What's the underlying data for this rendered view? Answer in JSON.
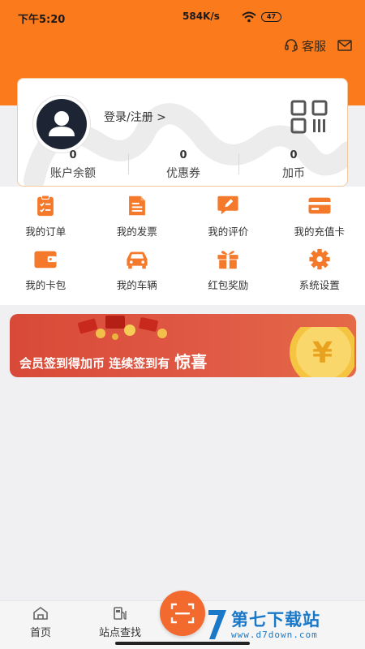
{
  "status_bar": {
    "time": "下午5:20",
    "network_speed": "584K/s",
    "battery": "47"
  },
  "header": {
    "customer_service_label": "客服",
    "customer_service_icon": "headset-icon",
    "message_icon": "mail-icon",
    "brand_color": "#fb7a1b"
  },
  "profile": {
    "avatar_icon": "user-avatar-icon",
    "login_label": "登录/注册 >",
    "qr_icon": "qr-code-icon",
    "stats": [
      {
        "value": "0",
        "label": "账户余额"
      },
      {
        "value": "0",
        "label": "优惠券"
      },
      {
        "value": "0",
        "label": "加币"
      }
    ]
  },
  "menu": {
    "icon_color": "#f4792a",
    "items": [
      {
        "label": "我的订单",
        "icon": "order-clipboard-icon"
      },
      {
        "label": "我的发票",
        "icon": "invoice-icon"
      },
      {
        "label": "我的评价",
        "icon": "review-edit-icon"
      },
      {
        "label": "我的充值卡",
        "icon": "recharge-card-icon"
      },
      {
        "label": "我的卡包",
        "icon": "wallet-icon"
      },
      {
        "label": "我的车辆",
        "icon": "car-icon"
      },
      {
        "label": "红包奖励",
        "icon": "gift-icon"
      },
      {
        "label": "系统设置",
        "icon": "gear-icon"
      }
    ]
  },
  "banner": {
    "text": "会员签到得加币 连续签到有",
    "highlight": "惊喜",
    "coin_icon": "yuan-coin-icon"
  },
  "tabbar": {
    "items": [
      {
        "label": "首页",
        "icon": "home-icon"
      },
      {
        "label": "站点查找",
        "icon": "fuel-station-icon"
      }
    ],
    "scan_icon": "scan-icon"
  },
  "watermark": {
    "title": "第七下载站",
    "url": "www.d7down.com"
  }
}
